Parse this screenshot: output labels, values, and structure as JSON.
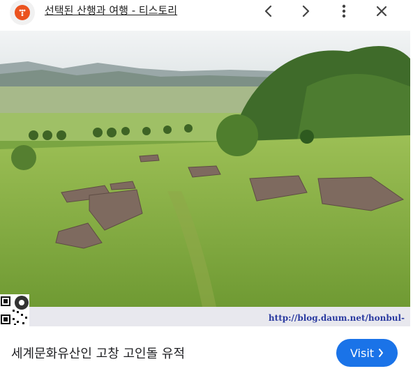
{
  "header": {
    "title": "선택된 산행과 여행 - 티스토리",
    "icons": [
      "site-favicon",
      "chevron-left-icon",
      "chevron-right-icon",
      "more-vert-icon",
      "close-icon"
    ]
  },
  "image": {
    "description_icon": "landscape-photo",
    "watermark": "http://blog.daum.net/honbul-"
  },
  "footer": {
    "caption": "세계문화유산인 고창 고인돌 유적",
    "visit_label": "Visit",
    "visit_icon": "chevron-right-icon"
  },
  "colors": {
    "accent": "#1a73e8",
    "favicon": "#eb531f",
    "watermark": "#2a3aa0"
  }
}
